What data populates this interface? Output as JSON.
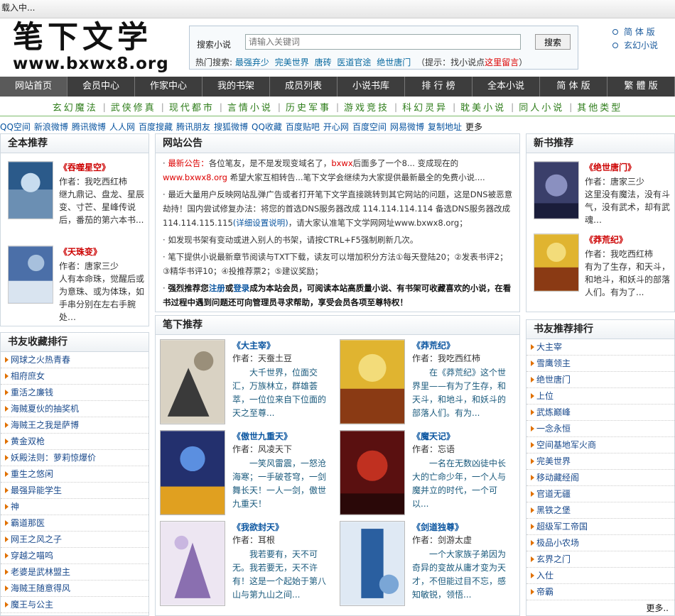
{
  "loading_text": "载入中...",
  "logo": {
    "title": "笔下文学",
    "url": "www.bxwx8.org"
  },
  "search": {
    "label": "搜索小说",
    "placeholder": "请输入关键词",
    "button": "搜索",
    "hot_label": "热门搜索:",
    "hot_terms": [
      "最强弃少",
      "完美世界",
      "唐砖",
      "医道官途",
      "绝世唐门"
    ],
    "tip_pre": "（提示：找小说点",
    "tip_link": "这里留言",
    "tip_post": "）"
  },
  "langs": [
    "简 体 版",
    "玄幻小说"
  ],
  "nav": [
    "网站首页",
    "会员中心",
    "作家中心",
    "我的书架",
    "成员列表",
    "小说书库",
    "排 行 榜",
    "全本小说",
    "简 体 版",
    "繁 體 版"
  ],
  "categories": [
    "玄幻魔法",
    "武侠修真",
    "现代都市",
    "言情小说",
    "历史军事",
    "游戏竞技",
    "科幻灵异",
    "耽美小说",
    "同人小说",
    "其他类型"
  ],
  "share": [
    "QQ空间",
    "新浪微博",
    "腾讯微博",
    "人人网",
    "百度搜藏",
    "腾讯朋友",
    "搜狐微博",
    "QQ收藏",
    "百度贴吧",
    "开心网",
    "百度空间",
    "网易微博",
    "复制地址"
  ],
  "share_more": "更多",
  "full_rec": {
    "title": "全本推荐",
    "books": [
      {
        "title": "《吞噬星空》",
        "author": "作者：我吃西红柿",
        "desc": "继九鼎记、盘龙、星辰变、寸芒、星峰传说后，番茄的第六本书..."
      },
      {
        "title": "《天珠变》",
        "author": "作者：唐家三少",
        "desc": "人有本命珠，觉醒后或为意珠、或为体珠，如手串分别在左右手腕处…"
      }
    ]
  },
  "collect": {
    "title": "书友收藏排行",
    "items": [
      "网球之火热青春",
      "相府庶女",
      "重活之廉钱",
      "海贼夏伙的抽奖机",
      "海贼王之我是萨博",
      "黄金双枪",
      "妖殿法则：萝莉惊爆价",
      "重生之悠闲",
      "最强异能学生",
      "神",
      "霸道那医",
      "网王之风之子",
      "穿越之喵呜",
      "老婆是武林盟主",
      "海贼王随意得风",
      "魔王与公主"
    ]
  },
  "notice": {
    "title": "网站公告",
    "p1_label": "最新公告：",
    "p1_a": "各位笔友，是不是发现变域名了，",
    "p1_domain": "bxwx",
    "p1_b": "后面多了一个",
    "p1_c": "8... 变成现在的",
    "p1_d": "www.bxwx8.org",
    "p1_e": " 希望大家互相转告...笔下文学会继续为大家提供最新最全的免费小说....",
    "p2": "最近大量用户反映网站乱弹广告或者打开笔下文学直接跳转到其它网站的问题，这是DNS被恶意劫持！国内尝试修复办法：将您的首选DNS服务器改成 114.114.114.114 备选DNS服务器改成 114.114.115.115",
    "p2_link": "(详细设置说明)",
    "p2_end": "，请大家认准笔下文学网网址www.bxwx8.org；",
    "p3": "如发现书架有变动或进入别人的书架，请按CTRL+F5强制刷新几次。",
    "p4": "笔下提供小说最新章节阅读与TXT下载，读友可以增加积分方法①每天登陆20；②发表书评2；③精华书评10；④投推荐票2；⑤建议奖励；",
    "p5_a": "强烈推荐您",
    "p5_reg": "注册",
    "p5_or": "或",
    "p5_login": "登录",
    "p5_b": "成为本站会员，可阅读本站高质量小说、有书架可收藏喜欢的小说，在看书过程中遇到问题还可向管理员寻求帮助，享受会员各项至尊特权！"
  },
  "pen_rec": {
    "title": "笔下推荐",
    "books": [
      {
        "title": "《大主宰》",
        "author": "作者：天蚕土豆",
        "desc": "大千世界，位面交汇，万族林立，群雄荟萃，一位位来自下位面的天之至尊..."
      },
      {
        "title": "《莽荒纪》",
        "author": "作者：我吃西红柿",
        "desc": "在《莽荒纪》这个世界里——有为了生存，和天斗，和地斗，和妖斗的部落人们。有为..."
      },
      {
        "title": "《傲世九重天》",
        "author": "作者：风凌天下",
        "desc": "一笑风雷震，一怒沧海寒；一手破苍穹，一剑舞长天！一人一剑，傲世九重天！"
      },
      {
        "title": "《魔天记》",
        "author": "作者：忘语",
        "desc": "一名在无数凶徒中长大的亡命少年，一个人与魔并立的时代，一个可以..."
      },
      {
        "title": "《我欲封天》",
        "author": "作者：耳根",
        "desc": "我若要有，天不可无。我若要无，天不许有！这是一个起始于第八山与第九山之间..."
      },
      {
        "title": "《剑道独尊》",
        "author": "作者：剑游太虚",
        "desc": "一个大家族子弟因为奇异的变故从庸才变为天才，不但能过目不忘，感知敏锐，领悟..."
      }
    ]
  },
  "new_books": {
    "title": "新书推荐",
    "books": [
      {
        "title": "《绝世唐门》",
        "author": "作者：唐家三少",
        "desc": "这里没有魔法，没有斗气，没有武术，却有武魂…"
      },
      {
        "title": "《莽荒纪》",
        "author": "作者：我吃西红柿",
        "desc": "有为了生存，和天斗，和地斗，和妖斗的部落人们。有为了..."
      }
    ]
  },
  "friend_rank": {
    "title": "书友推荐排行",
    "items": [
      "大主宰",
      "雪鹰领主",
      "绝世唐门",
      "上位",
      "武炼巅峰",
      "一念永恒",
      "空间基地军火商",
      "完美世界",
      "移动藏经阁",
      "官道无疆",
      "黑铁之堡",
      "超级军工帝国",
      "极品小农场",
      "玄界之门",
      "入仕",
      "帝霸"
    ],
    "more": "更多.."
  },
  "colors": {
    "nav_bg": "#3d3d3d",
    "category_green": "#2e7d1a",
    "title_red": "#cc0000",
    "link_blue": "#0a55a0"
  }
}
